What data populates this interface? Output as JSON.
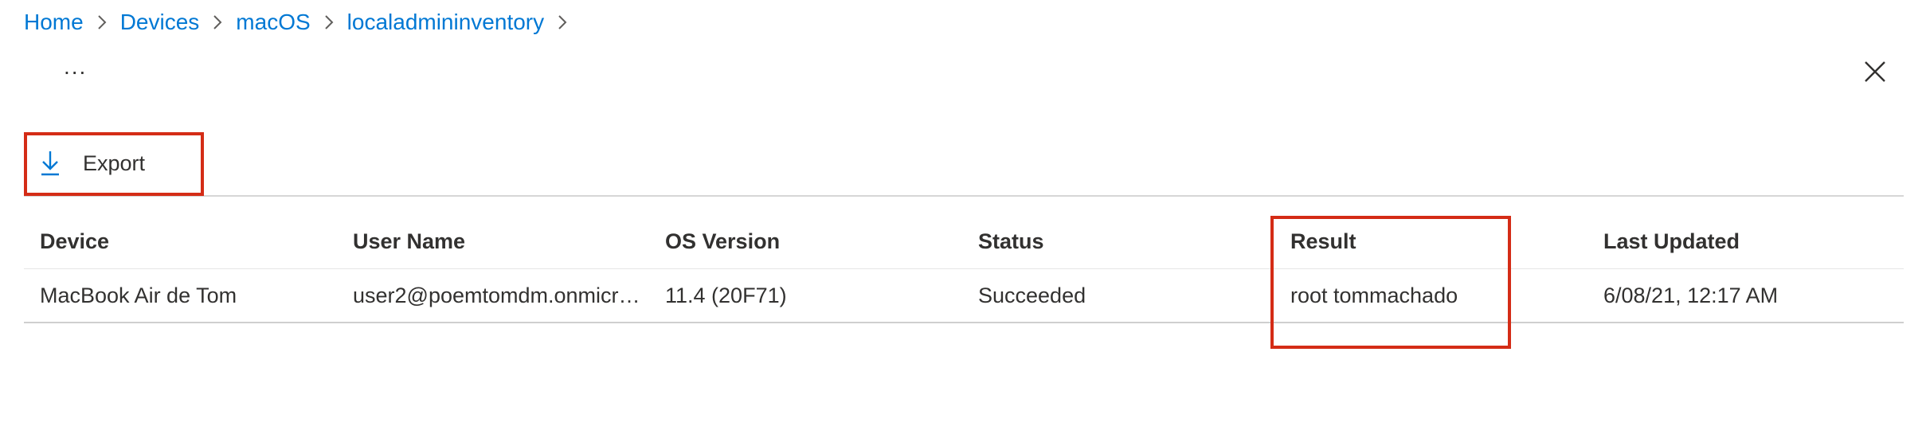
{
  "breadcrumb": {
    "items": [
      "Home",
      "Devices",
      "macOS",
      "localadmininventory"
    ]
  },
  "header": {
    "more_label": "..."
  },
  "toolbar": {
    "export_label": "Export"
  },
  "table": {
    "columns": [
      "Device",
      "User Name",
      "OS Version",
      "Status",
      "Result",
      "Last Updated"
    ],
    "rows": [
      [
        "MacBook Air de Tom",
        "user2@poemtomdm.onmicros...",
        "11.4 (20F71)",
        "Succeeded",
        "root tommachado",
        "6/08/21, 12:17 AM"
      ]
    ]
  },
  "colors": {
    "link": "#0078d4",
    "highlight": "#d42c16",
    "text": "#323130"
  }
}
